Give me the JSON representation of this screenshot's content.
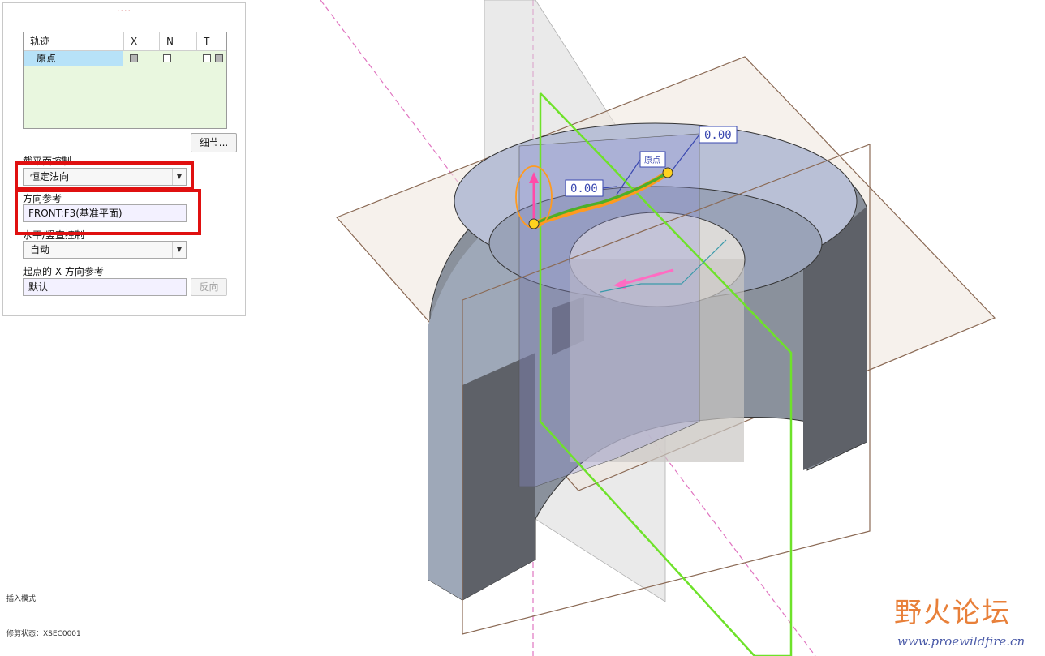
{
  "panel": {
    "grip": "....",
    "trajectory_table": {
      "headers": [
        "轨迹",
        "X",
        "N",
        "T"
      ],
      "rows": [
        {
          "name": "原点",
          "x": "filled",
          "n": "empty",
          "t": [
            "empty",
            "filled"
          ]
        }
      ]
    },
    "details_button": "细节...",
    "section_plane_control": {
      "label": "截平面控制",
      "value": "恒定法向"
    },
    "direction_reference": {
      "label": "方向参考",
      "value": "FRONT:F3(基准平面)"
    },
    "horizontal_vertical_control": {
      "label": "水平/竖直控制",
      "value": "自动"
    },
    "start_x_direction_ref": {
      "label": "起点的 X 方向参考",
      "value": "默认",
      "flip_button": "反向"
    }
  },
  "status_bar": {
    "mode": "插入模式",
    "section": "修剪状态：XSEC0001"
  },
  "viewport": {
    "dimension_left": "0.00",
    "dimension_top": "0.00",
    "origin_tag": "原点"
  },
  "watermark": {
    "title": "野火论坛",
    "url": "www.proewildfire.cn"
  },
  "colors": {
    "highlight": "#e01010",
    "trajectory_green": "#4caf2a",
    "plane_outline": "#8b6a55",
    "model_gray": "#5e6168",
    "selection_row": "#b7e2f8"
  }
}
